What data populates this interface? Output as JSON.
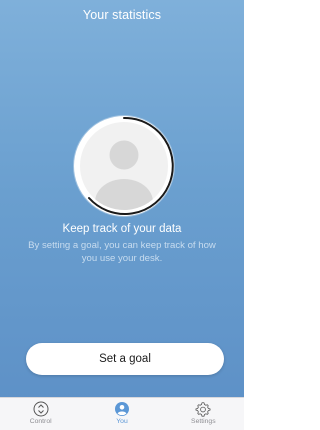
{
  "header": {
    "title": "Your statistics"
  },
  "empty_state": {
    "headline": "Keep track of your data",
    "description": "By setting a goal, you can keep track of how you use your desk.",
    "avatar_icon": "user-avatar-icon"
  },
  "actions": {
    "set_goal_label": "Set a goal"
  },
  "tabbar": {
    "tabs": [
      {
        "label": "Control",
        "icon": "control-arrows-icon",
        "active": false
      },
      {
        "label": "You",
        "icon": "user-icon",
        "active": true
      },
      {
        "label": "Settings",
        "icon": "gear-icon",
        "active": false
      }
    ]
  },
  "colors": {
    "background_top": "#7fb0da",
    "background_bottom": "#5c8fc6",
    "accent": "#5b97d6",
    "tab_inactive": "#8e8e93"
  }
}
